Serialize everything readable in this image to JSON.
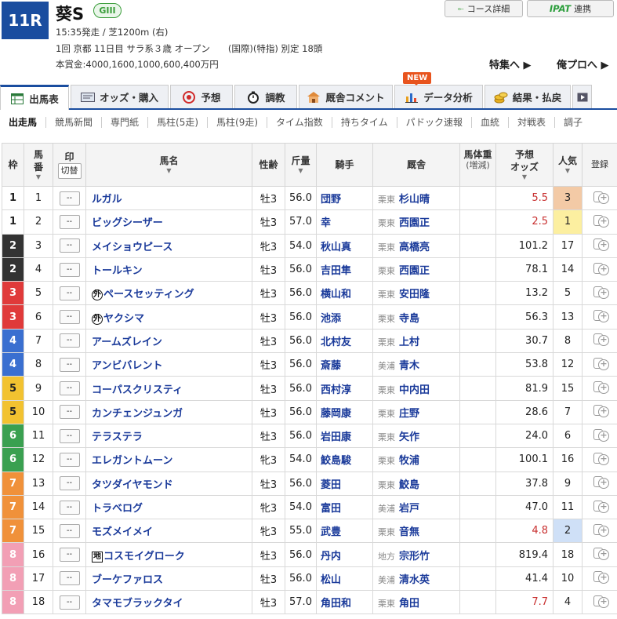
{
  "race": {
    "number": "11R",
    "name": "葵S",
    "grade": "GIII",
    "info1": "15:35発走 / 芝1200m (右)",
    "info2": "1回 京都 11日目 サラ系３歳 オープン　　(国際)(特指) 別定 18頭",
    "prize": "本賞金:4000,1600,1000,600,400万円"
  },
  "header": {
    "course_button": "コース詳細",
    "ipat_logo": "IPAT",
    "ipat_label": "連携",
    "link_tokushu": "特集へ ▶",
    "link_orepro": "俺プロへ ▶"
  },
  "tabs": [
    {
      "label": "出馬表",
      "icon": "table-icon"
    },
    {
      "label": "オッズ・購入",
      "icon": "odds-icon"
    },
    {
      "label": "予想",
      "icon": "target-icon"
    },
    {
      "label": "調教",
      "icon": "stopwatch-icon"
    },
    {
      "label": "厩舎コメント",
      "icon": "stable-icon"
    },
    {
      "label": "データ分析",
      "icon": "bar-chart-icon",
      "badge": "NEW"
    },
    {
      "label": "結果・払戻",
      "icon": "coins-icon"
    }
  ],
  "subtabs": [
    "出走馬",
    "競馬新聞",
    "専門紙",
    "馬柱(5走)",
    "馬柱(9走)",
    "タイム指数",
    "持ちタイム",
    "パドック速報",
    "血統",
    "対戦表",
    "調子"
  ],
  "columns": {
    "waku": "枠",
    "umaban": "馬\n番",
    "mark": "印",
    "mark_swap": "切替",
    "horse": "馬名",
    "sex_age": "性齢",
    "weight": "斤量",
    "jockey": "騎手",
    "stable": "厩舎",
    "body_weight": "馬体重",
    "body_weight_sub": "(増減)",
    "odds": "予想\nオッズ",
    "popularity": "人気",
    "register": "登録"
  },
  "mark_placeholder": "--",
  "waku_colors": {
    "1": "#ffffff",
    "2": "#333333",
    "3": "#e03a3a",
    "4": "#3a6fd0",
    "5": "#f2c230",
    "6": "#3aa050",
    "7": "#f0913a",
    "8": "#f29fb5"
  },
  "entries": [
    {
      "waku": "1",
      "num": "1",
      "name": "ルガル",
      "prefix": "",
      "sex": "牡3",
      "kin": "56.0",
      "jockey": "団野",
      "region": "栗東",
      "trainer": "杉山晴",
      "odds": "5.5",
      "pop": "3"
    },
    {
      "waku": "1",
      "num": "2",
      "name": "ビッグシーザー",
      "prefix": "",
      "sex": "牡3",
      "kin": "57.0",
      "jockey": "幸",
      "region": "栗東",
      "trainer": "西園正",
      "odds": "2.5",
      "pop": "1"
    },
    {
      "waku": "2",
      "num": "3",
      "name": "メイショウピース",
      "prefix": "",
      "sex": "牝3",
      "kin": "54.0",
      "jockey": "秋山真",
      "region": "栗東",
      "trainer": "高橋亮",
      "odds": "101.2",
      "pop": "17"
    },
    {
      "waku": "2",
      "num": "4",
      "name": "トールキン",
      "prefix": "",
      "sex": "牡3",
      "kin": "56.0",
      "jockey": "吉田隼",
      "region": "栗東",
      "trainer": "西園正",
      "odds": "78.1",
      "pop": "14"
    },
    {
      "waku": "3",
      "num": "5",
      "name": "ペースセッティング",
      "prefix": "外",
      "sex": "牡3",
      "kin": "56.0",
      "jockey": "横山和",
      "region": "栗東",
      "trainer": "安田隆",
      "odds": "13.2",
      "pop": "5"
    },
    {
      "waku": "3",
      "num": "6",
      "name": "ヤクシマ",
      "prefix": "外",
      "sex": "牡3",
      "kin": "56.0",
      "jockey": "池添",
      "region": "栗東",
      "trainer": "寺島",
      "odds": "56.3",
      "pop": "13"
    },
    {
      "waku": "4",
      "num": "7",
      "name": "アームズレイン",
      "prefix": "",
      "sex": "牡3",
      "kin": "56.0",
      "jockey": "北村友",
      "region": "栗東",
      "trainer": "上村",
      "odds": "30.7",
      "pop": "8"
    },
    {
      "waku": "4",
      "num": "8",
      "name": "アンビバレント",
      "prefix": "",
      "sex": "牡3",
      "kin": "56.0",
      "jockey": "斎藤",
      "region": "美浦",
      "trainer": "青木",
      "odds": "53.8",
      "pop": "12"
    },
    {
      "waku": "5",
      "num": "9",
      "name": "コーパスクリスティ",
      "prefix": "",
      "sex": "牡3",
      "kin": "56.0",
      "jockey": "西村淳",
      "region": "栗東",
      "trainer": "中内田",
      "odds": "81.9",
      "pop": "15"
    },
    {
      "waku": "5",
      "num": "10",
      "name": "カンチェンジュンガ",
      "prefix": "",
      "sex": "牡3",
      "kin": "56.0",
      "jockey": "藤岡康",
      "region": "栗東",
      "trainer": "庄野",
      "odds": "28.6",
      "pop": "7"
    },
    {
      "waku": "6",
      "num": "11",
      "name": "テラステラ",
      "prefix": "",
      "sex": "牡3",
      "kin": "56.0",
      "jockey": "岩田康",
      "region": "栗東",
      "trainer": "矢作",
      "odds": "24.0",
      "pop": "6"
    },
    {
      "waku": "6",
      "num": "12",
      "name": "エレガントムーン",
      "prefix": "",
      "sex": "牝3",
      "kin": "54.0",
      "jockey": "鮫島駿",
      "region": "栗東",
      "trainer": "牧浦",
      "odds": "100.1",
      "pop": "16"
    },
    {
      "waku": "7",
      "num": "13",
      "name": "タツダイヤモンド",
      "prefix": "",
      "sex": "牡3",
      "kin": "56.0",
      "jockey": "菱田",
      "region": "栗東",
      "trainer": "鮫島",
      "odds": "37.8",
      "pop": "9"
    },
    {
      "waku": "7",
      "num": "14",
      "name": "トラベログ",
      "prefix": "",
      "sex": "牝3",
      "kin": "54.0",
      "jockey": "富田",
      "region": "美浦",
      "trainer": "岩戸",
      "odds": "47.0",
      "pop": "11"
    },
    {
      "waku": "7",
      "num": "15",
      "name": "モズメイメイ",
      "prefix": "",
      "sex": "牝3",
      "kin": "55.0",
      "jockey": "武豊",
      "region": "栗東",
      "trainer": "音無",
      "odds": "4.8",
      "pop": "2"
    },
    {
      "waku": "8",
      "num": "16",
      "name": "コスモイグローク",
      "prefix": "地",
      "sex": "牡3",
      "kin": "56.0",
      "jockey": "丹内",
      "region": "地方",
      "trainer": "宗形竹",
      "odds": "819.4",
      "pop": "18"
    },
    {
      "waku": "8",
      "num": "17",
      "name": "ブーケファロス",
      "prefix": "",
      "sex": "牡3",
      "kin": "56.0",
      "jockey": "松山",
      "region": "美浦",
      "trainer": "清水英",
      "odds": "41.4",
      "pop": "10"
    },
    {
      "waku": "8",
      "num": "18",
      "name": "タマモブラックタイ",
      "prefix": "",
      "sex": "牡3",
      "kin": "57.0",
      "jockey": "角田和",
      "region": "栗東",
      "trainer": "角田",
      "odds": "7.7",
      "pop": "4"
    }
  ]
}
